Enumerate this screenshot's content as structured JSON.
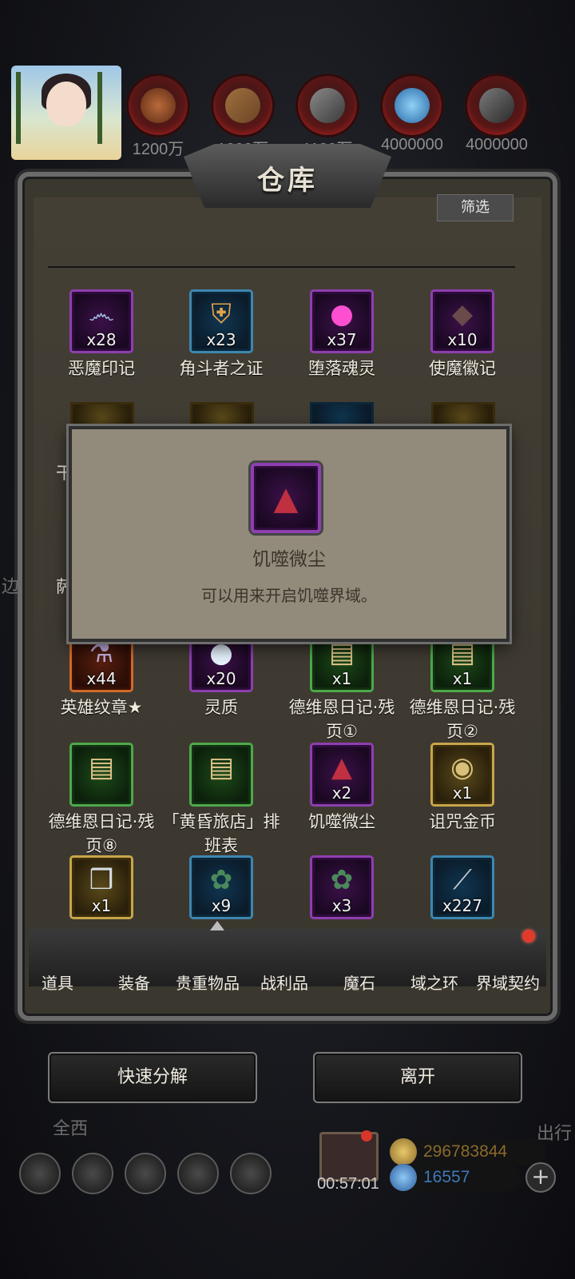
{
  "resources": [
    {
      "name": "wood-logs-icon",
      "amount": "1200万"
    },
    {
      "name": "plank-icon",
      "amount": "1200万"
    },
    {
      "name": "iron-ingot-icon",
      "amount": "1130万"
    },
    {
      "name": "crystal-icon",
      "amount": "4000000"
    },
    {
      "name": "stone-icon",
      "amount": "4000000"
    }
  ],
  "panel": {
    "title": "仓库",
    "filter_label": "筛选"
  },
  "items_row1": [
    {
      "name": "恶魔印记",
      "qty": "x28",
      "rarity": "purple",
      "icon": "swirl-icon"
    },
    {
      "name": "角斗者之证",
      "qty": "x23",
      "rarity": "blue",
      "icon": "shield-emblem-icon"
    },
    {
      "name": "堕落魂灵",
      "qty": "x37",
      "rarity": "purple",
      "icon": "pink-flame-icon"
    },
    {
      "name": "使魔徽记",
      "qty": "x10",
      "rarity": "purple",
      "icon": "dark-insignia-icon"
    }
  ],
  "hidden_row_partial": {
    "left1": "干",
    "right1": "晶",
    "left2": "萨"
  },
  "items_row4": [
    {
      "name": "英雄纹章★",
      "qty": "x44",
      "rarity": "orange",
      "icon": "crest-vial-icon"
    },
    {
      "name": "灵质",
      "qty": "x20",
      "rarity": "purple",
      "icon": "white-orb-icon"
    },
    {
      "name": "德维恩日记·残页①",
      "qty": "x1",
      "rarity": "green",
      "icon": "scroll-icon"
    },
    {
      "name": "德维恩日记·残页②",
      "qty": "x1",
      "rarity": "green",
      "icon": "scroll-icon"
    }
  ],
  "items_row5": [
    {
      "name": "德维恩日记·残页⑧",
      "qty": "",
      "rarity": "green",
      "icon": "scroll-icon"
    },
    {
      "name": "「黄昏旅店」排班表",
      "qty": "",
      "rarity": "green",
      "icon": "scroll-icon"
    },
    {
      "name": "饥噬微尘",
      "qty": "x2",
      "rarity": "purple",
      "icon": "red-dust-icon"
    },
    {
      "name": "诅咒金币",
      "qty": "x1",
      "rarity": "gold",
      "icon": "gold-coin-icon"
    }
  ],
  "items_row6": [
    {
      "qty": "x1",
      "rarity": "gold",
      "icon": "cube-icon"
    },
    {
      "qty": "x9",
      "rarity": "blue",
      "icon": "green-ore-icon"
    },
    {
      "qty": "x3",
      "rarity": "purple",
      "icon": "green-ore-icon"
    },
    {
      "qty": "x227",
      "rarity": "blue",
      "icon": "feather-icon"
    }
  ],
  "tooltip": {
    "name": "饥噬微尘",
    "description": "可以用来开启饥噬界域。"
  },
  "tabs": [
    "道具",
    "装备",
    "贵重物品",
    "战利品",
    "魔石",
    "域之环",
    "界域契约"
  ],
  "buttons": {
    "quick_decompose": "快速分解",
    "leave": "离开"
  },
  "hud": {
    "timer": "00:57:01",
    "gold": "296783844",
    "gems": "16557",
    "side_left": "全西",
    "side_right": "出行",
    "side_edge": "边"
  },
  "colors": {
    "purple_rarity": "#8e3fb0",
    "blue_rarity": "#3d87b0",
    "green_rarity": "#4ea84a",
    "orange_rarity": "#d06a2a",
    "gold_rarity": "#c7a54a",
    "tooltip_bg": "#928a7a",
    "gold_text": "#8a6a2a",
    "gem_text": "#3f78b8"
  }
}
